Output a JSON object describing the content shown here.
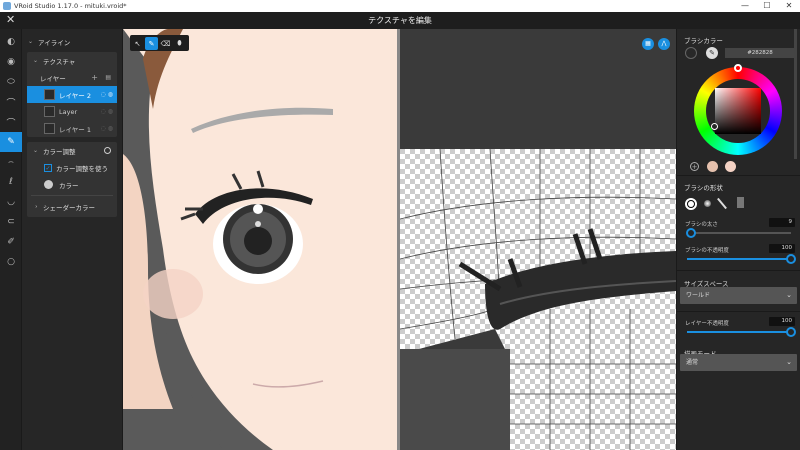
{
  "window": {
    "title": "VRoid Studio 1.17.0 - mituki.vroid*",
    "controls": [
      "—",
      "☐",
      "✕"
    ]
  },
  "header": {
    "title": "テクスチャを編集",
    "close_glyph": "✕"
  },
  "iconbar": {
    "items": [
      {
        "icon": "face-icon",
        "glyph": "◐"
      },
      {
        "icon": "eyebrow-icon",
        "glyph": "◉"
      },
      {
        "icon": "eye-icon",
        "glyph": "⬭"
      },
      {
        "icon": "eyelash-icon",
        "glyph": "⌒"
      },
      {
        "icon": "brush-icon",
        "glyph": "✎",
        "active": true
      },
      {
        "icon": "mouth-icon",
        "glyph": "⌢"
      },
      {
        "icon": "nose-icon",
        "glyph": "ℓ"
      },
      {
        "icon": "lip-icon",
        "glyph": "◡"
      },
      {
        "icon": "ear-icon",
        "glyph": "⊂"
      },
      {
        "icon": "accessory-icon",
        "glyph": "✐"
      },
      {
        "icon": "outline-icon",
        "glyph": "○"
      }
    ]
  },
  "left_panel": {
    "section_title": "アイライン",
    "texture": {
      "title": "テクスチャ",
      "layers_label": "レイヤー",
      "add_glyph": "+",
      "layers": [
        {
          "name": "レイヤー 2",
          "selected": true
        },
        {
          "name": "Layer",
          "selected": false
        },
        {
          "name": "レイヤー 1",
          "selected": false
        }
      ]
    },
    "color_adjust": {
      "title": "カラー調整",
      "use_label": "カラー調整を使う",
      "use_checked": true,
      "color_label": "カラー"
    },
    "shader": {
      "title": "シェーダーカラー"
    }
  },
  "canvas_toolbar": {
    "tools": [
      {
        "icon": "select-icon",
        "glyph": "↖"
      },
      {
        "icon": "pen-icon",
        "glyph": "✎",
        "active": true
      },
      {
        "icon": "eraser-icon",
        "glyph": "⌫"
      },
      {
        "icon": "fill-icon",
        "glyph": "⬮"
      }
    ]
  },
  "canvas_buttons": [
    {
      "icon": "grid-icon",
      "glyph": "▦"
    },
    {
      "icon": "symmetry-icon",
      "glyph": "⋀"
    }
  ],
  "right_panel": {
    "brush_color": {
      "title": "ブラシカラー",
      "hex": "#282828"
    },
    "brush_shape": {
      "title": "ブラシの形状"
    },
    "brush_size": {
      "label": "ブラシの太さ",
      "value": "9",
      "fraction": 0.04
    },
    "brush_opacity": {
      "label": "ブラシの不透明度",
      "value": "100",
      "fraction": 1.0
    },
    "size_space": {
      "title": "サイズスペース",
      "value": "ワールド"
    },
    "layer_opacity": {
      "label": "レイヤー不透明度",
      "value": "100",
      "fraction": 1.0
    },
    "blend_mode": {
      "title": "描画モード",
      "value": "通常"
    },
    "swatches": [
      "#e5c1ad",
      "#f4d2c4"
    ]
  },
  "colors": {
    "accent": "#1a8fe0",
    "skin": "#fbe7da",
    "hair": "#8a5a3c"
  }
}
